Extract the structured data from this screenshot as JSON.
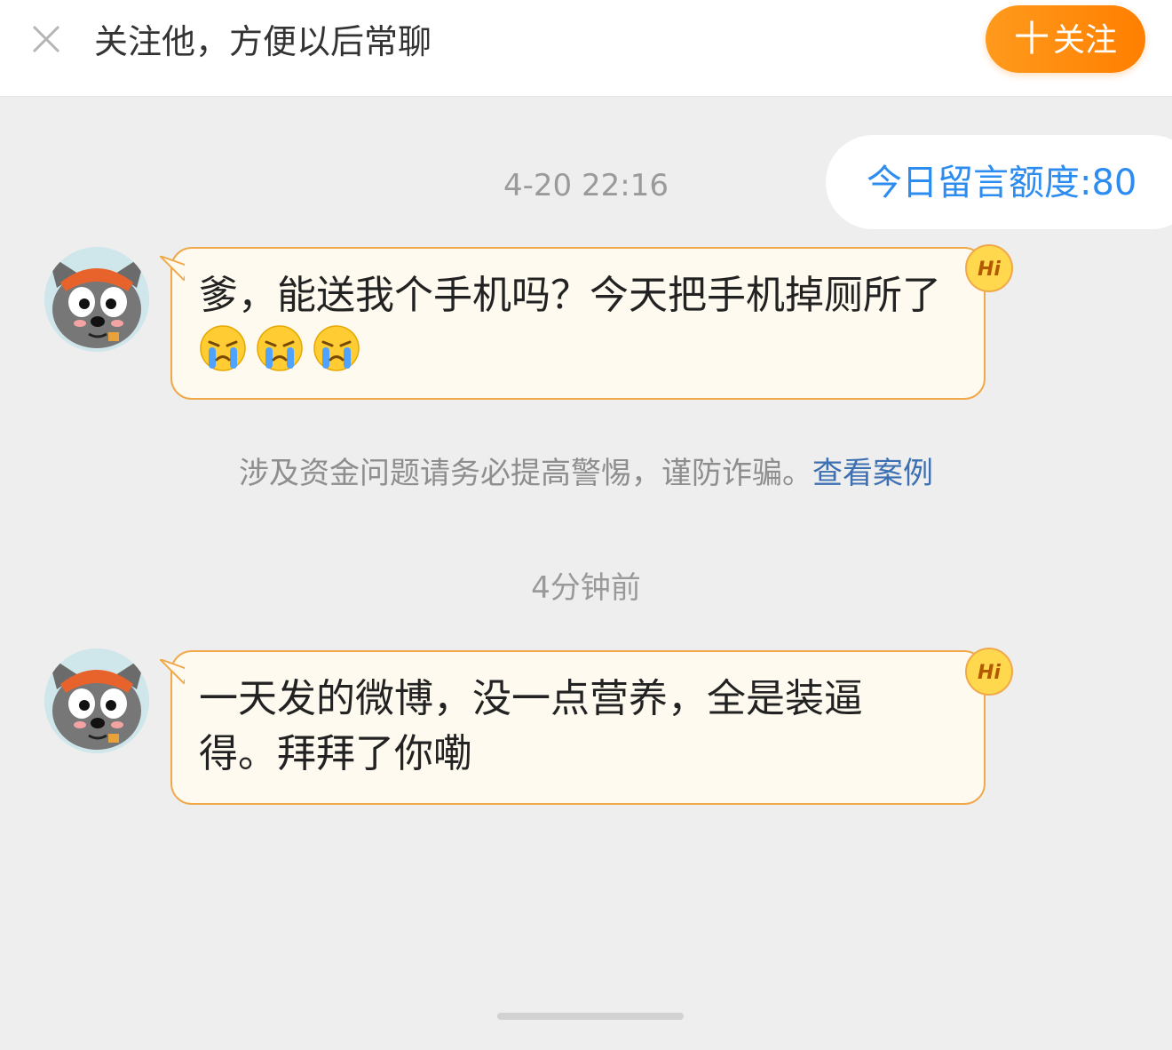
{
  "topbar": {
    "prompt": "关注他，方便以后常聊",
    "follow_label": "关注",
    "follow_plus": "十",
    "accent_color": "#ff8a00"
  },
  "quota": {
    "label": "今日留言额度:80"
  },
  "messages": [
    {
      "timestamp": "4-20 22:16",
      "text": "爹，能送我个手机吗？今天把手机掉厕所了",
      "emojis": [
        "crying-face-icon",
        "crying-face-icon",
        "crying-face-icon"
      ]
    },
    {
      "timestamp": "4分钟前",
      "text": "一天发的微博，没一点营养，全是装逼得。拜拜了你嘞",
      "emojis": []
    }
  ],
  "warning": {
    "text": "涉及资金问题请务必提高警惕，谨防诈骗。",
    "link": "查看案例"
  },
  "badge": {
    "text": "Hi"
  }
}
